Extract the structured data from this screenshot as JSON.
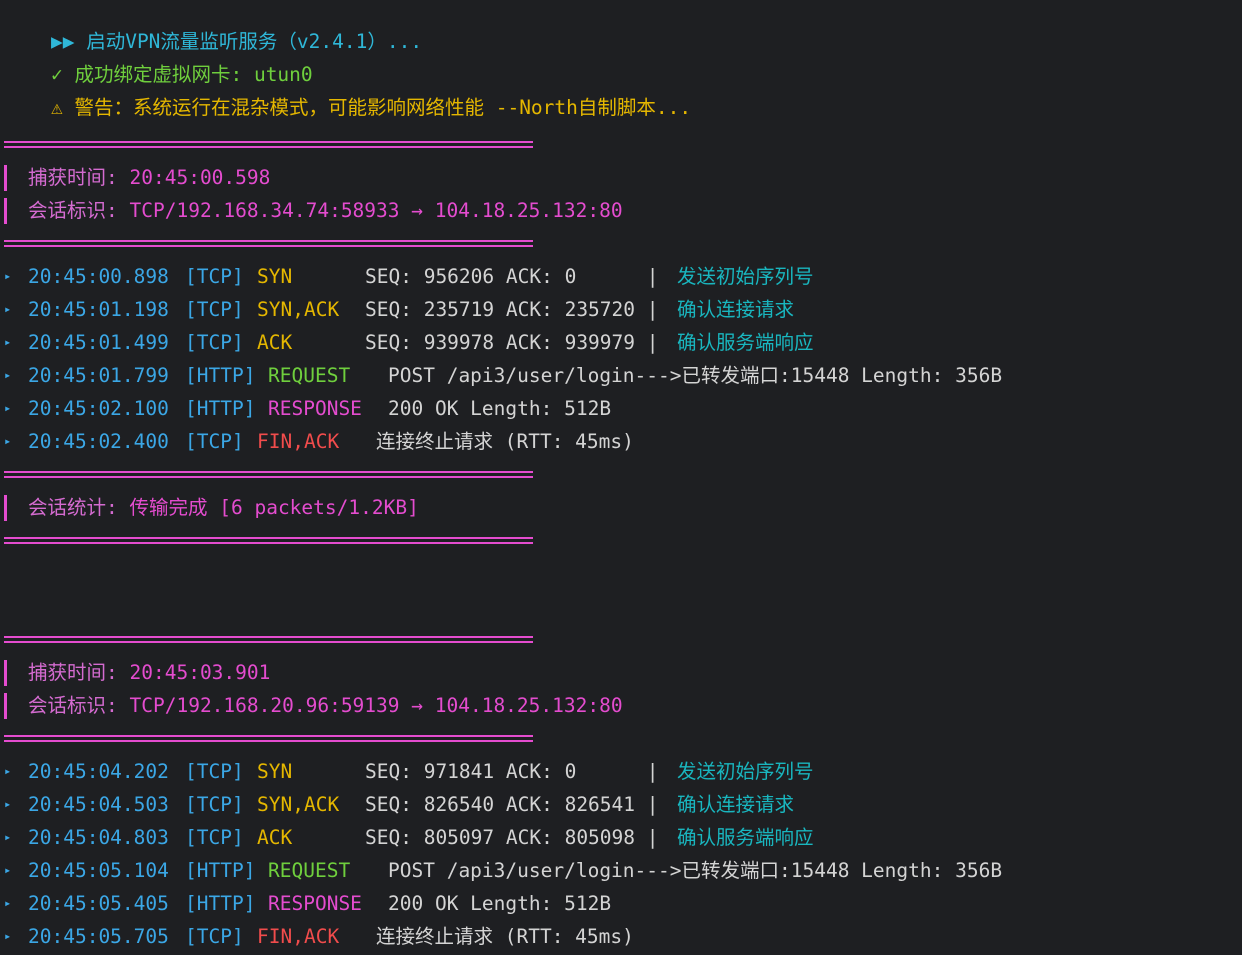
{
  "header": {
    "start_icon": "▶▶",
    "start_text": "启动VPN流量监听服务（v2.4.1）...",
    "ok_icon": "✓",
    "ok_text": "成功绑定虚拟网卡: utun0",
    "warn_icon": "⚠",
    "warn_text": "警告：系统运行在混杂模式，可能影响网络性能 --North自制脚本..."
  },
  "sessions": [
    {
      "capture_label": "捕获时间:",
      "capture_time": "20:45:00.598",
      "id_label": "会话标识:",
      "id_value": "TCP/192.168.34.74:58933 → 104.18.25.132:80",
      "packets": [
        {
          "time": "20:45:00.898",
          "proto": "[TCP]",
          "flag": "SYN",
          "flag_color": "yellow",
          "detail": "SEQ: 956206 ACK: 0      |",
          "note": "发送初始序列号"
        },
        {
          "time": "20:45:01.198",
          "proto": "[TCP]",
          "flag": "SYN,ACK",
          "flag_color": "yellow",
          "detail": "SEQ: 235719 ACK: 235720 |",
          "note": "确认连接请求"
        },
        {
          "time": "20:45:01.499",
          "proto": "[TCP]",
          "flag": "ACK",
          "flag_color": "yellow",
          "detail": "SEQ: 939978 ACK: 939979 |",
          "note": "确认服务端响应"
        },
        {
          "time": "20:45:01.799",
          "proto": "[HTTP]",
          "flag": "REQUEST",
          "flag_color": "green",
          "detail": "POST /api3/user/login--->已转发端口:15448 Length: 356B",
          "note": ""
        },
        {
          "time": "20:45:02.100",
          "proto": "[HTTP]",
          "flag": "RESPONSE",
          "flag_color": "pink",
          "detail": "200 OK Length: 512B",
          "note": ""
        },
        {
          "time": "20:45:02.400",
          "proto": "[TCP]",
          "flag": "FIN,ACK",
          "flag_color": "red",
          "detail": "连接终止请求 (RTT: 45ms)",
          "note": ""
        }
      ],
      "stats_label": "会话统计:",
      "stats_value": "传输完成 [6 packets/1.2KB]"
    },
    {
      "capture_label": "捕获时间:",
      "capture_time": "20:45:03.901",
      "id_label": "会话标识:",
      "id_value": "TCP/192.168.20.96:59139 → 104.18.25.132:80",
      "packets": [
        {
          "time": "20:45:04.202",
          "proto": "[TCP]",
          "flag": "SYN",
          "flag_color": "yellow",
          "detail": "SEQ: 971841 ACK: 0      |",
          "note": "发送初始序列号"
        },
        {
          "time": "20:45:04.503",
          "proto": "[TCP]",
          "flag": "SYN,ACK",
          "flag_color": "yellow",
          "detail": "SEQ: 826540 ACK: 826541 |",
          "note": "确认连接请求"
        },
        {
          "time": "20:45:04.803",
          "proto": "[TCP]",
          "flag": "ACK",
          "flag_color": "yellow",
          "detail": "SEQ: 805097 ACK: 805098 |",
          "note": "确认服务端响应"
        },
        {
          "time": "20:45:05.104",
          "proto": "[HTTP]",
          "flag": "REQUEST",
          "flag_color": "green",
          "detail": "POST /api3/user/login--->已转发端口:15448 Length: 356B",
          "note": ""
        },
        {
          "time": "20:45:05.405",
          "proto": "[HTTP]",
          "flag": "RESPONSE",
          "flag_color": "pink",
          "detail": "200 OK Length: 512B",
          "note": ""
        },
        {
          "time": "20:45:05.705",
          "proto": "[TCP]",
          "flag": "FIN,ACK",
          "flag_color": "red",
          "detail": "连接终止请求 (RTT: 45ms)",
          "note": ""
        }
      ]
    }
  ],
  "icons": {
    "packet_bullet": "triangle-right-icon",
    "start": "double-play-icon",
    "ok": "checkmark-icon",
    "warn": "warning-icon"
  },
  "colors": {
    "background": "#1e1f22",
    "accent_pink": "#e44ccf",
    "timestamp_blue": "#3ba7e6",
    "note_teal": "#19b6bf",
    "flag_yellow": "#e5b700",
    "flag_green": "#6fcf3d",
    "flag_red": "#f14c4c"
  }
}
